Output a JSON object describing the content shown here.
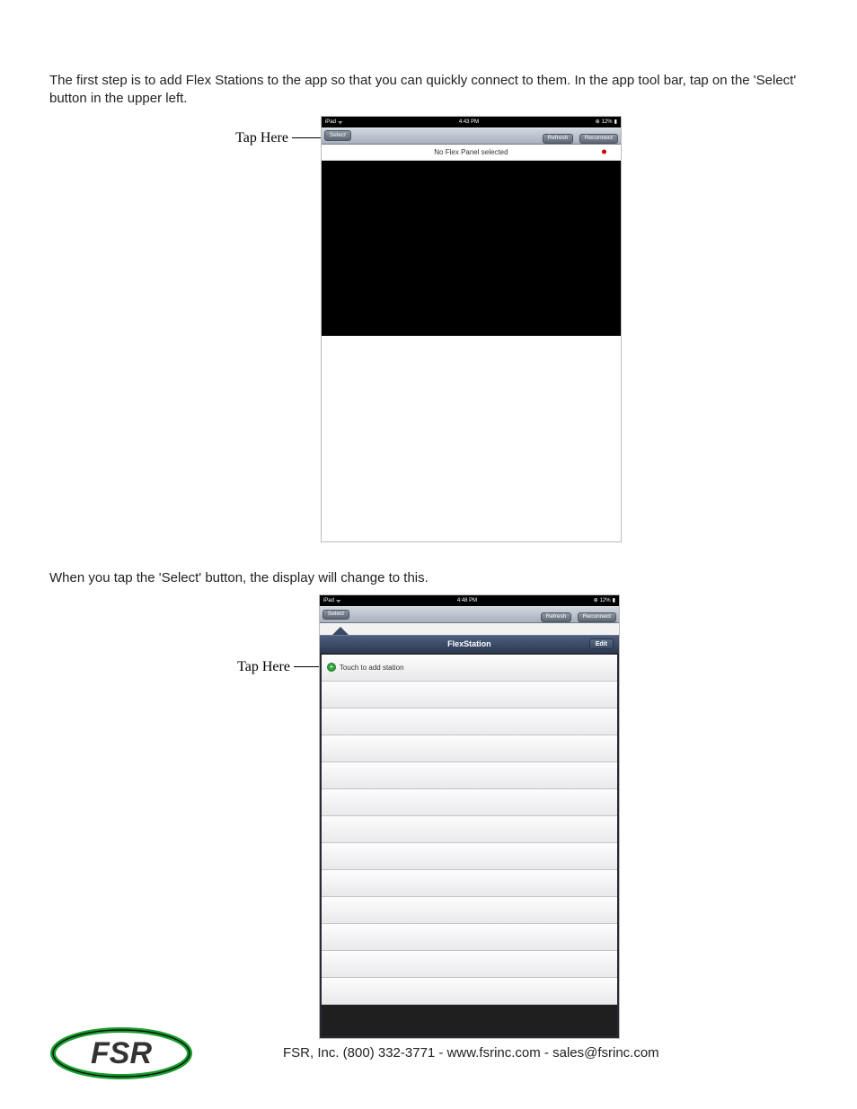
{
  "para1": "The first step is to add Flex Stations to the app so that you can quickly connect to them. In the app tool bar, tap on the 'Select' button in the upper left.",
  "callout1": "Tap Here",
  "ipad1": {
    "status_left": "iPad",
    "status_time": "4:43 PM",
    "status_right": "12%",
    "select": "Select",
    "refresh": "Refresh",
    "reconnect": "Reconnect",
    "panel_msg": "No Flex Panel selected"
  },
  "para2": "When you tap the 'Select' button, the display will change to this.",
  "callout2": "Tap Here",
  "ipad2": {
    "status_left": "iPad",
    "status_time": "4:48 PM",
    "status_right": "12%",
    "select": "Select",
    "refresh": "Refresh",
    "reconnect": "Reconnect",
    "pop_title": "FlexStation",
    "edit": "Edit",
    "add_row": "Touch to add station"
  },
  "footer": "FSR, Inc. (800) 332-3771 - www.fsrinc.com - sales@fsrinc.com",
  "logo_text": "FSR"
}
